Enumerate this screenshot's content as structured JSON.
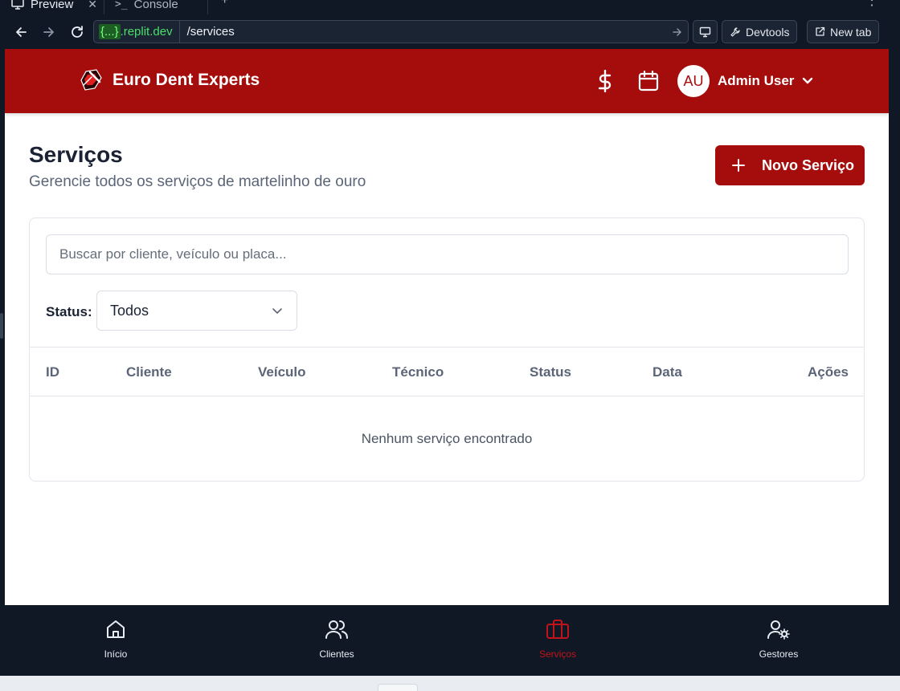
{
  "browser": {
    "tabs": [
      {
        "label": "Preview",
        "active": true
      },
      {
        "label": "Console",
        "active": false
      }
    ],
    "url_host": "{...}",
    "url_host_suffix": ".replit.dev",
    "url_path": "/services",
    "devtools_label": "Devtools",
    "newtab_label": "New tab"
  },
  "header": {
    "brand": "Euro Dent Experts",
    "user_initials": "AU",
    "user_name": "Admin User",
    "brand_color": "#a50d0d"
  },
  "page": {
    "title": "Serviços",
    "subtitle": "Gerencie todos os serviços de martelinho de ouro",
    "new_button": "Novo Serviço"
  },
  "filters": {
    "search_placeholder": "Buscar por cliente, veículo ou placa...",
    "search_value": "",
    "status_label": "Status:",
    "status_value": "Todos"
  },
  "table": {
    "columns": [
      "ID",
      "Cliente",
      "Veículo",
      "Técnico",
      "Status",
      "Data",
      "Ações"
    ],
    "rows": [],
    "empty_message": "Nenhum serviço encontrado"
  },
  "bottom_nav": {
    "items": [
      {
        "label": "Início",
        "icon": "home-icon",
        "active": false
      },
      {
        "label": "Clientes",
        "icon": "users-icon",
        "active": false
      },
      {
        "label": "Serviços",
        "icon": "briefcase-icon",
        "active": true
      },
      {
        "label": "Gestores",
        "icon": "user-gear-icon",
        "active": false
      }
    ],
    "active_color": "#c0131a"
  }
}
